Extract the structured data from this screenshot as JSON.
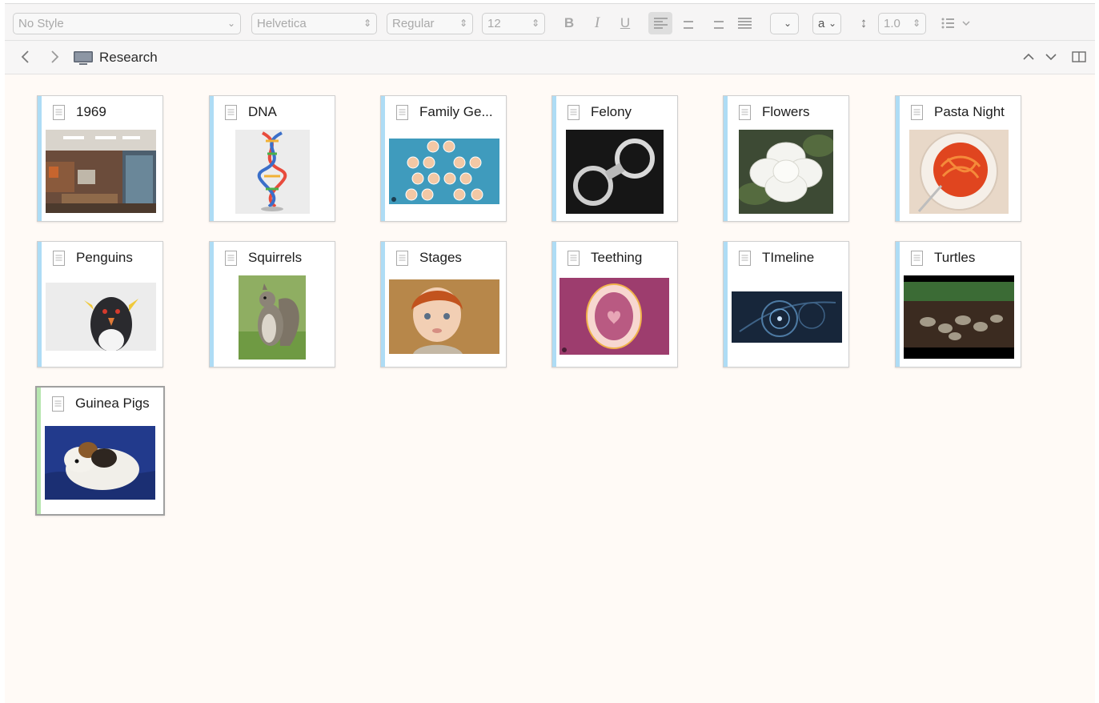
{
  "toolbar": {
    "style": "No Style",
    "font": "Helvetica",
    "weight": "Regular",
    "size": "12",
    "bold": "B",
    "italic": "I",
    "underline": "U",
    "text_color": "a",
    "line_spacing": "1.0"
  },
  "pathbar": {
    "title": "Research"
  },
  "cards": [
    {
      "title": "1969"
    },
    {
      "title": "DNA"
    },
    {
      "title": "Family Ge..."
    },
    {
      "title": "Felony"
    },
    {
      "title": "Flowers"
    },
    {
      "title": "Pasta Night"
    },
    {
      "title": "Penguins"
    },
    {
      "title": "Squirrels"
    },
    {
      "title": "Stages"
    },
    {
      "title": "Teething"
    },
    {
      "title": "TImeline"
    },
    {
      "title": "Turtles"
    },
    {
      "title": "Guinea Pigs"
    }
  ],
  "colors": {
    "stripe": "#aedcf5",
    "stripe_selected": "#b7e6b0",
    "background": "#fffaf6"
  }
}
